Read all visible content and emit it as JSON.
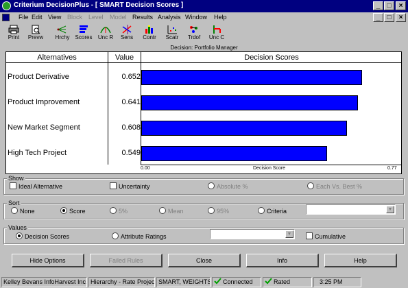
{
  "window": {
    "title": "Criterium DecisionPlus - [ SMART Decision Scores ]",
    "controls": {
      "minimize": "_",
      "maximize": "□",
      "close": "×"
    }
  },
  "menu": {
    "items": [
      {
        "label": "File",
        "enabled": true
      },
      {
        "label": "Edit",
        "enabled": true
      },
      {
        "label": "View",
        "enabled": true
      },
      {
        "label": "Block",
        "enabled": false
      },
      {
        "label": "Level",
        "enabled": false
      },
      {
        "label": "Model",
        "enabled": false
      },
      {
        "label": "Results",
        "enabled": true
      },
      {
        "label": "Analysis",
        "enabled": true
      },
      {
        "label": "Window",
        "enabled": true
      },
      {
        "label": "Help",
        "enabled": true
      }
    ]
  },
  "toolbar": {
    "buttons": [
      {
        "label": "Print",
        "icon": "printer-icon"
      },
      {
        "label": "Prevw",
        "icon": "preview-icon"
      },
      {
        "label": "Hrchy",
        "icon": "hierarchy-icon"
      },
      {
        "label": "Scores",
        "icon": "scores-icon"
      },
      {
        "label": "Unc R",
        "icon": "uncertainty-r-icon"
      },
      {
        "label": "Sens",
        "icon": "sensitivity-icon"
      },
      {
        "label": "Contr",
        "icon": "contributions-icon"
      },
      {
        "label": "Scatr",
        "icon": "scatter-icon"
      },
      {
        "label": "Trdof",
        "icon": "tradeoff-icon"
      },
      {
        "label": "Unc C",
        "icon": "uncertainty-c-icon"
      }
    ]
  },
  "decision_header": "Decision: Portfolio Manager",
  "chart_data": {
    "type": "bar",
    "orientation": "horizontal",
    "columns": {
      "alternatives": "Alternatives",
      "value": "Value",
      "scores": "Decision Scores"
    },
    "categories": [
      "Product Derivative",
      "Product Improvement",
      "New Market Segment",
      "High Tech Project"
    ],
    "values": [
      0.652,
      0.641,
      0.608,
      0.549
    ],
    "value_labels": [
      "0.652",
      "0.641",
      "0.608",
      "0.549"
    ],
    "xlabel": "Decision Score",
    "xlim": [
      0.0,
      0.77
    ],
    "xtick_labels": [
      "0.00",
      "0.77"
    ],
    "bar_color": "#0000ff"
  },
  "show": {
    "title": "Show",
    "options": [
      {
        "label": "Ideal Alternative",
        "type": "checkbox",
        "checked": false,
        "enabled": true
      },
      {
        "label": "Uncertainty",
        "type": "checkbox",
        "checked": false,
        "enabled": true
      },
      {
        "label": "Absolute %",
        "type": "radio",
        "checked": false,
        "enabled": false
      },
      {
        "label": "Each Vs. Best %",
        "type": "radio",
        "checked": false,
        "enabled": false
      }
    ]
  },
  "sort": {
    "title": "Sort",
    "options": [
      {
        "label": "None",
        "checked": false,
        "enabled": true
      },
      {
        "label": "Score",
        "checked": true,
        "enabled": true
      },
      {
        "label": "5%",
        "checked": false,
        "enabled": false
      },
      {
        "label": "Mean",
        "checked": false,
        "enabled": false
      },
      {
        "label": "95%",
        "checked": false,
        "enabled": false
      },
      {
        "label": "Criteria",
        "checked": false,
        "enabled": true
      }
    ],
    "criteria_value": ""
  },
  "values": {
    "title": "Values",
    "options": [
      {
        "label": "Decision Scores",
        "type": "radio",
        "checked": true
      },
      {
        "label": "Attribute Ratings",
        "type": "radio",
        "checked": false
      },
      {
        "label": "Cumulative",
        "type": "checkbox",
        "checked": false
      }
    ],
    "attribute_value": ""
  },
  "buttons": [
    {
      "label": "Hide Options",
      "enabled": true
    },
    {
      "label": "Failed Rules",
      "enabled": false
    },
    {
      "label": "Close",
      "enabled": true
    },
    {
      "label": "Info",
      "enabled": true
    },
    {
      "label": "Help",
      "enabled": true
    }
  ],
  "status": {
    "user": "Kelley Bevans InfoHarvest Inc.",
    "mode": "Hierarchy - Rate Projects",
    "method": "SMART, WEIGHTS",
    "connected": "Connected",
    "rated": "Rated",
    "time": "3:25 PM"
  },
  "colors": {
    "title_bar": "#000080",
    "face": "#c0c0c0",
    "bar": "#0000ff",
    "check": "#00a000"
  }
}
